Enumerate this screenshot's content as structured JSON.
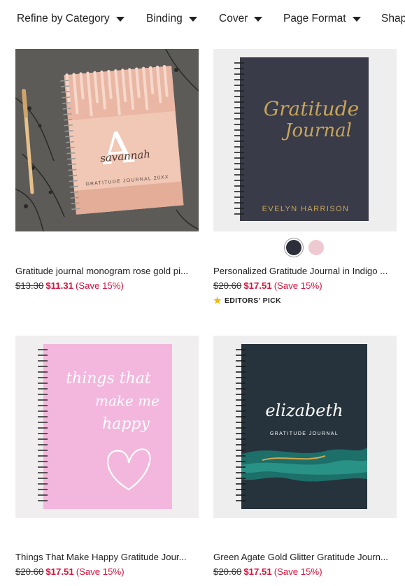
{
  "filters": [
    {
      "label": "Refine by Category"
    },
    {
      "label": "Binding"
    },
    {
      "label": "Cover"
    },
    {
      "label": "Page Format"
    },
    {
      "label": "Shap"
    }
  ],
  "products": [
    {
      "title": "Gratitude journal monogram rose gold pi...",
      "orig_price": "$13.30",
      "sale_price": "$11.31",
      "savings": "(Save 15%)",
      "cover_name": "savannah",
      "cover_initial": "A",
      "cover_footer": "GRATITUDE JOURNAL 20XX"
    },
    {
      "title": "Personalized Gratitude Journal in Indigo ...",
      "orig_price": "$20.60",
      "sale_price": "$17.51",
      "savings": "(Save 15%)",
      "badge": "EDITORS' PICK",
      "cover_title_1": "Gratitude",
      "cover_title_2": "Journal",
      "cover_name": "EVELYN HARRISON",
      "swatch_colors": [
        "#2c2f3a",
        "#efc9d2"
      ]
    },
    {
      "title": "Things That Make Happy Gratitude Jour...",
      "orig_price": "$20.60",
      "sale_price": "$17.51",
      "savings": "(Save 15%)",
      "cover_line_1": "things that",
      "cover_line_2": "make me",
      "cover_line_3": "happy"
    },
    {
      "title": "Green Agate Gold Glitter Gratitude Journ...",
      "orig_price": "$20.60",
      "sale_price": "$17.51",
      "savings": "(Save 15%)",
      "cover_name": "elizabeth",
      "cover_sub": "GRATITUDE JOURNAL"
    }
  ],
  "colors": {
    "sale": "#d4143c",
    "star": "#f2b705"
  }
}
